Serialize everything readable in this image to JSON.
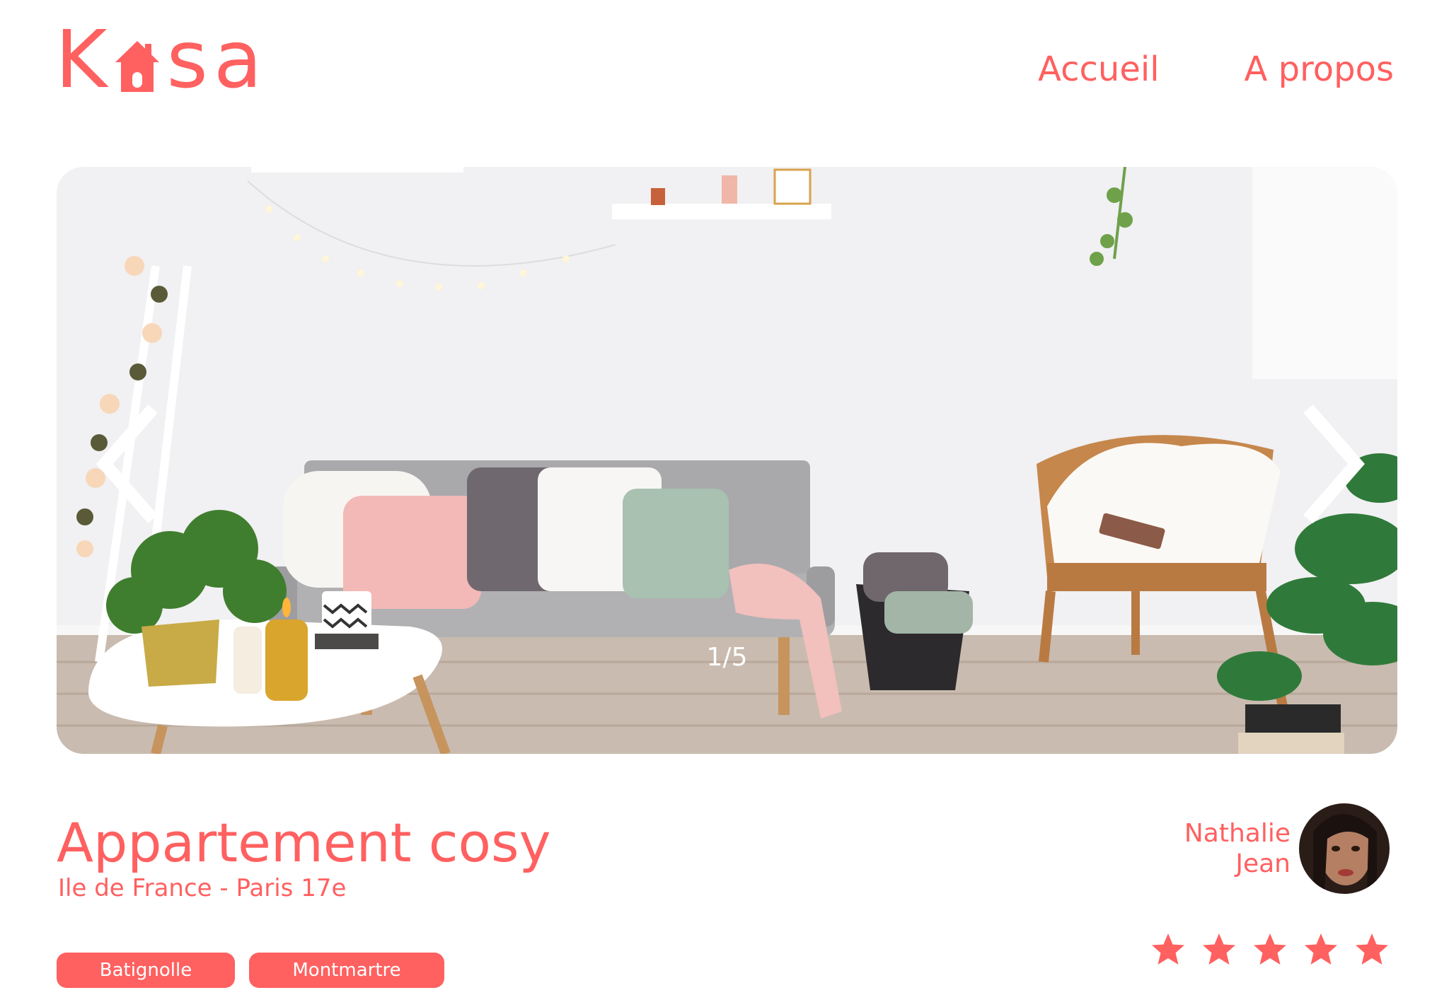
{
  "header": {
    "logo_letters": [
      "K",
      "s",
      "a"
    ],
    "logo_text": "Kasa",
    "nav": [
      {
        "label": "Accueil"
      },
      {
        "label": "A propos"
      }
    ]
  },
  "gallery": {
    "counter": "1/5",
    "current": 1,
    "total": 5
  },
  "listing": {
    "title": "Appartement cosy",
    "location": "Ile de France - Paris 17e",
    "tags": [
      "Batignolle",
      "Montmartre"
    ],
    "host": {
      "first_name": "Nathalie",
      "last_name": "Jean"
    },
    "rating": 5,
    "rating_max": 5
  },
  "colors": {
    "brand": "#FF6060",
    "white": "#ffffff",
    "star_inactive": "#E3E3E3"
  },
  "icons": {
    "logo": "house-icon",
    "prev": "chevron-left-icon",
    "next": "chevron-right-icon",
    "star": "star-icon"
  }
}
